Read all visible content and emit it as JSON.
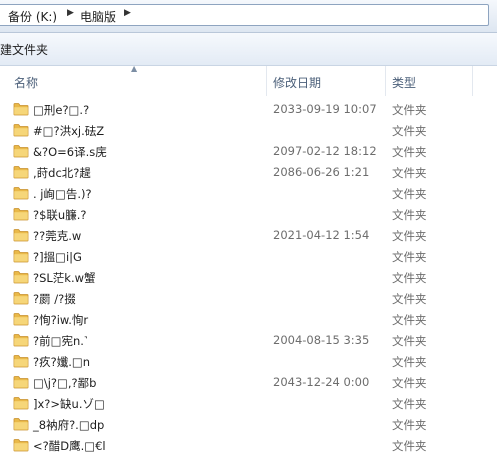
{
  "address": {
    "crumbs": [
      "备份 (K:)",
      "电脑版"
    ]
  },
  "toolbar": {
    "new_folder_label": "建文件夹"
  },
  "columns": {
    "name": "名称",
    "date": "修改日期",
    "type": "类型"
  },
  "files": [
    {
      "name": "□刑e?□.?",
      "date": "2033-09-19 10:07",
      "type": "文件夹"
    },
    {
      "name": "#□?洪xj.砝Z",
      "date": "",
      "type": "文件夹"
    },
    {
      "name": "&?O=6译.s庑",
      "date": "2097-02-12 18:12",
      "type": "文件夹"
    },
    {
      "name": ",莳dc北?趧",
      "date": "2086-06-26 1:21",
      "type": "文件夹"
    },
    {
      "name": ". j峋□告.)?",
      "date": "",
      "type": "文件夹"
    },
    {
      "name": "?$联u臁.?",
      "date": "",
      "type": "文件夹"
    },
    {
      "name": "??莞克.w",
      "date": "2021-04-12 1:54",
      "type": "文件夹"
    },
    {
      "name": "?]搵□i|G",
      "date": "",
      "type": "文件夹"
    },
    {
      "name": "?SL茫k.w蟹",
      "date": "",
      "type": "文件夹"
    },
    {
      "name": "?罽 /?掇",
      "date": "",
      "type": "文件夹"
    },
    {
      "name": "?恂?iw.恂r",
      "date": "",
      "type": "文件夹"
    },
    {
      "name": "?前□宪n.˺",
      "date": "2004-08-15 3:35",
      "type": "文件夹"
    },
    {
      "name": "?疚?孅.□n",
      "date": "",
      "type": "文件夹"
    },
    {
      "name": "□\\j?□,?鄙b",
      "date": "2043-12-24 0:00",
      "type": "文件夹"
    },
    {
      "name": "]x?>缺u.ゾ□",
      "date": "",
      "type": "文件夹"
    },
    {
      "name": "_8衲府?.□dp",
      "date": "",
      "type": "文件夹"
    },
    {
      "name": "<?醋D鹰.□€l",
      "date": "",
      "type": "文件夹"
    }
  ]
}
